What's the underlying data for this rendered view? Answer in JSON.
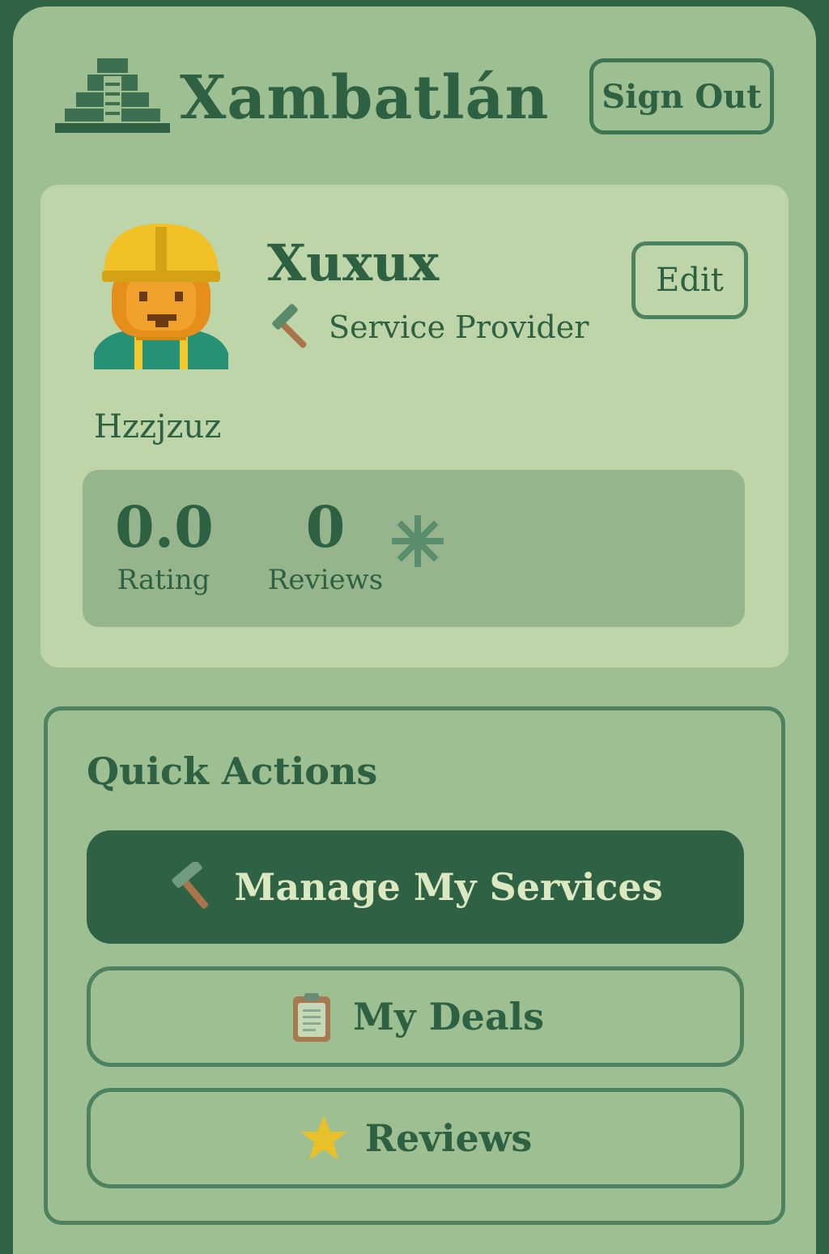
{
  "header": {
    "brand": "Xambatlán",
    "signout_label": "Sign Out"
  },
  "profile": {
    "name": "Xuxux",
    "role": "Service Provider",
    "edit_label": "Edit",
    "bio": "Hzzjzuz",
    "stats": {
      "rating_value": "0.0",
      "rating_label": "Rating",
      "reviews_value": "0",
      "reviews_label": "Reviews"
    }
  },
  "quick_actions": {
    "title": "Quick Actions",
    "items": [
      {
        "label": "Manage My Services",
        "icon": "hammer-icon"
      },
      {
        "label": "My Deals",
        "icon": "clipboard-icon"
      },
      {
        "label": "Reviews",
        "icon": "star-icon"
      }
    ]
  },
  "colors": {
    "primary": "#2f6244",
    "background": "#9ebf92",
    "card": "#bdd5a8",
    "accent_star": "#e8c02a"
  }
}
